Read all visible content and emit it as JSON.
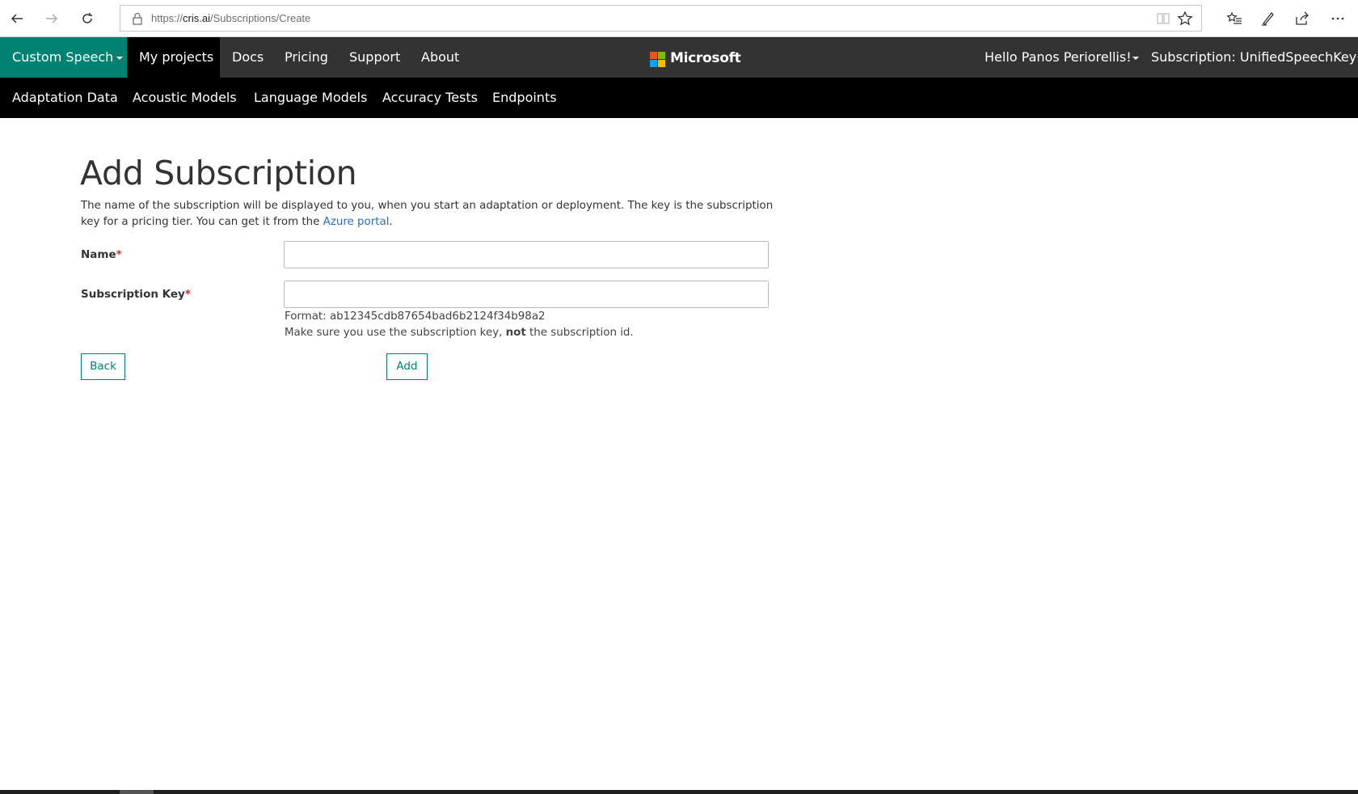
{
  "browser": {
    "url_scheme": "https://",
    "url_host": "cris.ai",
    "url_path": "/Subscriptions/Create"
  },
  "topnav": {
    "brand": "Custom Speech",
    "items": [
      "My projects",
      "Docs",
      "Pricing",
      "Support",
      "About"
    ],
    "logo_text": "Microsoft",
    "user": "Hello Panos Periorellis!",
    "subscription": "Subscription: UnifiedSpeechKey"
  },
  "subnav": {
    "items": [
      "Adaptation Data",
      "Acoustic Models",
      "Language Models",
      "Accuracy Tests",
      "Endpoints"
    ]
  },
  "page": {
    "title": "Add Subscription",
    "desc_part1": "The name of the subscription will be displayed to you, when you start an adaptation or deployment. The key is the subscription key for a pricing tier. You can get it from the ",
    "desc_link": "Azure portal",
    "desc_part2": ".",
    "name_label": "Name",
    "name_value": "",
    "key_label": "Subscription Key",
    "key_value": "",
    "required_mark": "*",
    "format_hint": "Format: ab12345cdb87654bad6b2124f34b98a2",
    "hint_part1": "Make sure you use the subscription key, ",
    "hint_bold": "not",
    "hint_part2": " the subscription id.",
    "back_label": "Back",
    "add_label": "Add"
  },
  "colors": {
    "brand_green": "#008272",
    "nav_dark": "#333333",
    "subnav_black": "#000000",
    "link_blue": "#2a6ebb",
    "required_red": "#c9302c"
  },
  "icons": [
    "back-arrow-icon",
    "forward-arrow-icon",
    "refresh-icon",
    "lock-icon",
    "reading-view-icon",
    "favorite-star-icon",
    "favorites-list-icon",
    "pen-icon",
    "share-icon",
    "more-icon"
  ]
}
